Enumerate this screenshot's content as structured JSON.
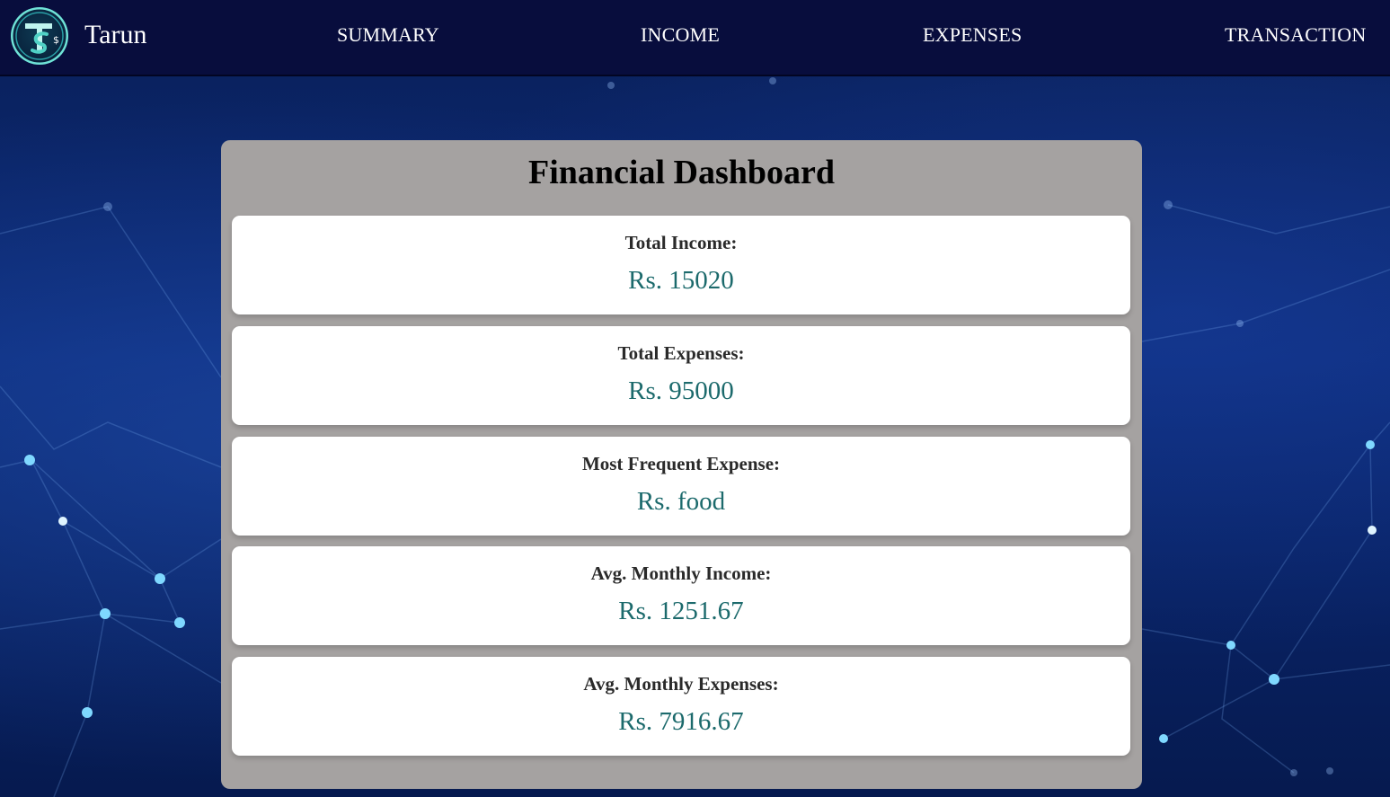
{
  "navbar": {
    "brand": "Tarun",
    "logo_icon": "ts-dollar-logo-icon",
    "links": [
      "SUMMARY",
      "INCOME",
      "EXPENSES",
      "TRANSACTION"
    ]
  },
  "dashboard": {
    "title": "Financial Dashboard",
    "cards": [
      {
        "label": "Total Income:",
        "value": "Rs. 15020"
      },
      {
        "label": "Total Expenses:",
        "value": "Rs. 95000"
      },
      {
        "label": "Most Frequent Expense:",
        "value": "Rs. food"
      },
      {
        "label": "Avg. Monthly Income:",
        "value": "Rs. 1251.67"
      },
      {
        "label": "Avg. Monthly Expenses:",
        "value": "Rs. 7916.67"
      }
    ]
  },
  "colors": {
    "navbar": "#080d3d",
    "panel": "#a5a2a1",
    "value_text": "#1c6a6c",
    "background": "#0b2a78"
  }
}
